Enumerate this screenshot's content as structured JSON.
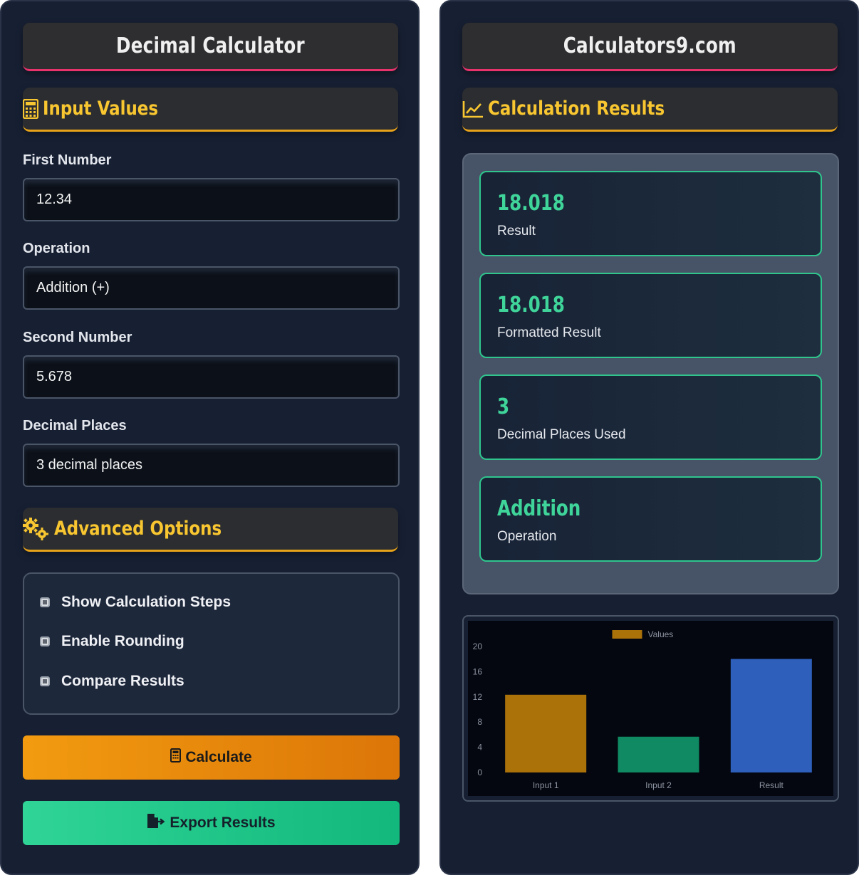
{
  "left_panel": {
    "title": "Decimal Calculator",
    "input_section": {
      "title": "Input Values",
      "icon": "calculator-icon"
    },
    "first_number": {
      "label": "First Number",
      "value": "12.34"
    },
    "operation": {
      "label": "Operation",
      "value": "Addition (+)"
    },
    "second_number": {
      "label": "Second Number",
      "value": "5.678"
    },
    "decimal_places": {
      "label": "Decimal Places",
      "value": "3 decimal places"
    },
    "advanced_section": {
      "title": "Advanced Options",
      "icon": "gears-icon"
    },
    "options": [
      {
        "label": "Show Calculation Steps"
      },
      {
        "label": "Enable Rounding"
      },
      {
        "label": "Compare Results"
      }
    ],
    "buttons": {
      "calculate": "Calculate",
      "export": "Export Results"
    }
  },
  "right_panel": {
    "title": "Calculators9.com",
    "results_section": {
      "title": "Calculation Results",
      "icon": "chart-line-icon"
    },
    "results": [
      {
        "value": "18.018",
        "label": "Result"
      },
      {
        "value": "18.018",
        "label": "Formatted Result"
      },
      {
        "value": "3",
        "label": "Decimal Places Used"
      },
      {
        "value": "Addition",
        "label": "Operation"
      }
    ]
  },
  "colors": {
    "panel_bg": "#172033",
    "accent_yellow": "#f8c630",
    "accent_green": "#3fd49a",
    "accent_pink": "#e8336c"
  },
  "chart_data": {
    "type": "bar",
    "categories": [
      "Input 1",
      "Input 2",
      "Result"
    ],
    "series": [
      {
        "name": "Values",
        "values": [
          12.34,
          5.678,
          18.018
        ]
      }
    ],
    "bar_colors": [
      "#ab720a",
      "#0f8a62",
      "#2e5fba"
    ],
    "legend_color": "#ab720a",
    "yticks": [
      "0",
      "4",
      "8",
      "12",
      "16",
      "20"
    ],
    "ylim": [
      0,
      20
    ],
    "legend_position": "top-center",
    "grid": false
  }
}
